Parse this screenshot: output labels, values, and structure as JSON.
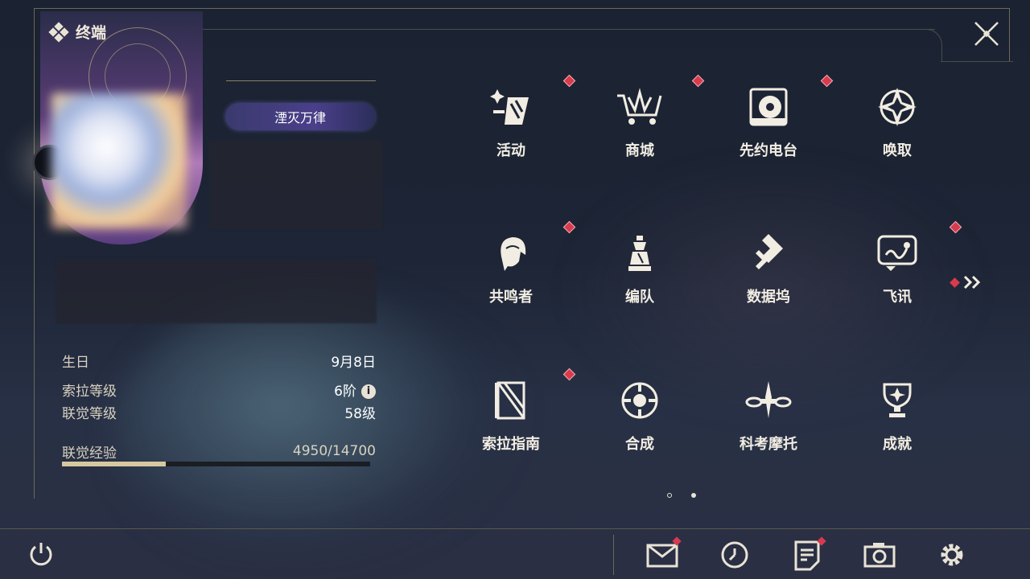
{
  "header": {
    "title": "终端"
  },
  "profile": {
    "badge_label": "湮灭万律",
    "stats": [
      {
        "label": "生日",
        "value": "9月8日"
      },
      {
        "label": "索拉等级",
        "value": "6阶"
      },
      {
        "label": "联觉等级",
        "value": "58级"
      }
    ],
    "xp": {
      "label": "联觉经验",
      "value": "4950/14700",
      "fraction": 0.337
    }
  },
  "menu": {
    "items": [
      {
        "label": "活动",
        "icon": "event-icon",
        "notify": true
      },
      {
        "label": "商城",
        "icon": "shop-cart-icon",
        "notify": true
      },
      {
        "label": "先约电台",
        "icon": "radio-icon",
        "notify": true
      },
      {
        "label": "唤取",
        "icon": "convene-icon",
        "notify": false
      },
      {
        "label": "共鸣者",
        "icon": "resonator-icon",
        "notify": true
      },
      {
        "label": "编队",
        "icon": "team-icon",
        "notify": false
      },
      {
        "label": "数据坞",
        "icon": "data-bank-icon",
        "notify": false
      },
      {
        "label": "飞讯",
        "icon": "message-icon",
        "notify": true
      },
      {
        "label": "索拉指南",
        "icon": "guidebook-icon",
        "notify": true
      },
      {
        "label": "合成",
        "icon": "synthesis-icon",
        "notify": false
      },
      {
        "label": "科考摩托",
        "icon": "motorcycle-icon",
        "notify": false
      },
      {
        "label": "成就",
        "icon": "trophy-icon",
        "notify": false
      }
    ],
    "pages": 2,
    "current_page": 1
  },
  "bottom_bar": {
    "items": [
      {
        "icon": "mail-icon",
        "notify": true
      },
      {
        "icon": "clock-icon",
        "notify": false
      },
      {
        "icon": "notes-icon",
        "notify": true
      },
      {
        "icon": "camera-icon",
        "notify": false
      },
      {
        "icon": "settings-gear-icon",
        "notify": false
      }
    ]
  },
  "colors": {
    "notify": "#d83a4e",
    "text": "#f2ede2",
    "accent": "#d8c8a0"
  }
}
